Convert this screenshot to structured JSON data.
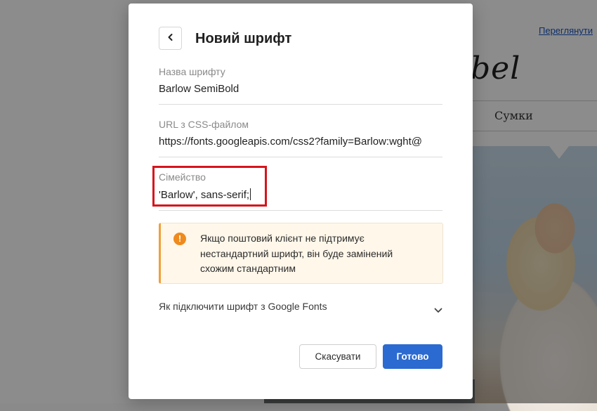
{
  "background": {
    "preview_link": "Переглянути",
    "brand": "bel",
    "nav_item": "Сумки"
  },
  "modal": {
    "title": "Новий шрифт",
    "back_icon": "chevron-left-icon",
    "fields": {
      "font_name": {
        "label": "Назва шрифту",
        "value": "Barlow SemiBold"
      },
      "css_url": {
        "label": "URL з CSS-файлом",
        "value": "https://fonts.googleapis.com/css2?family=Barlow:wght@"
      },
      "family": {
        "label": "Сімейство",
        "value": "'Barlow', sans-serif;"
      }
    },
    "notice": {
      "icon": "exclamation-icon",
      "text": "Якщо поштовий клієнт не підтримує нестандартний шрифт, він буде замінений схожим стандартним"
    },
    "accordion": {
      "label": "Як підключити шрифт з Google Fonts",
      "icon": "chevron-down-icon"
    },
    "buttons": {
      "cancel": "Скасувати",
      "ok": "Готово"
    }
  },
  "colors": {
    "accent": "#2b6ad0",
    "highlight": "#d6141c",
    "warning": "#ef8a1c",
    "notice_bg": "#fff7ea"
  }
}
